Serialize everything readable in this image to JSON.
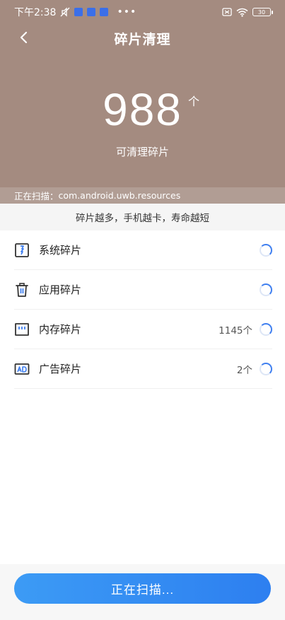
{
  "status_bar": {
    "time": "下午2:38",
    "battery": "30"
  },
  "header": {
    "title": "碎片清理"
  },
  "summary": {
    "count": "988",
    "unit": "个",
    "label": "可清理碎片"
  },
  "scan": {
    "label": "正在扫描：",
    "current_item": "com.android.uwb.resources"
  },
  "tip": "碎片越多，手机越卡，寿命越短",
  "items": [
    {
      "label": "系统碎片",
      "count": "",
      "icon": "system-fragment-icon"
    },
    {
      "label": "应用碎片",
      "count": "",
      "icon": "trash-icon"
    },
    {
      "label": "内存碎片",
      "count": "1145个",
      "icon": "sd-card-icon"
    },
    {
      "label": "广告碎片",
      "count": "2个",
      "icon": "ad-icon"
    }
  ],
  "footer": {
    "button_label": "正在扫描..."
  },
  "colors": {
    "hero": "#a48b80",
    "accent": "#2d7ff0"
  }
}
